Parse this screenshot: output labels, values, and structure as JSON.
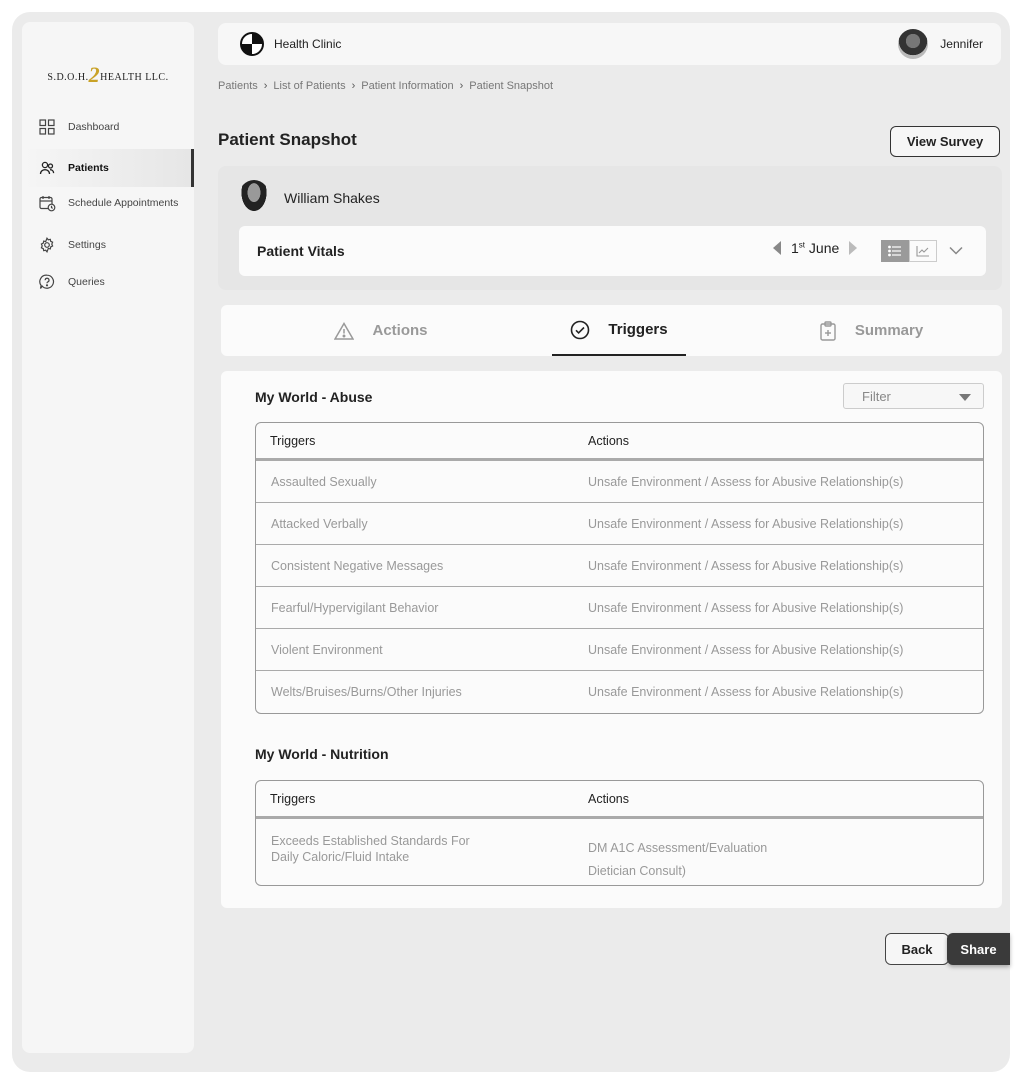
{
  "logo": {
    "prefix": "S.D.O.H.",
    "two": "2",
    "suffix": "HEALTH LLC."
  },
  "sidebar": {
    "items": [
      {
        "label": "Dashboard",
        "icon": "grid-icon"
      },
      {
        "label": "Patients",
        "icon": "users-icon",
        "active": true
      },
      {
        "label": "Schedule Appointments",
        "icon": "calendar-clock-icon"
      },
      {
        "label": "Settings",
        "icon": "gear-icon"
      },
      {
        "label": "Queries",
        "icon": "question-icon"
      }
    ]
  },
  "header": {
    "clinic": "Health Clinic",
    "user": "Jennifer"
  },
  "breadcrumb": [
    "Patients",
    "List of Patients",
    "Patient Information",
    "Patient Snapshot"
  ],
  "page": {
    "title": "Patient Snapshot",
    "view_survey": "View Survey"
  },
  "patient": {
    "name": "William Shakes"
  },
  "vitals": {
    "label": "Patient Vitals",
    "date_day": "1",
    "date_suffix": "st",
    "date_month": "June"
  },
  "tabs": [
    {
      "label": "Actions",
      "icon": "warning-icon"
    },
    {
      "label": "Triggers",
      "icon": "check-circle-icon",
      "active": true
    },
    {
      "label": "Summary",
      "icon": "clipboard-plus-icon"
    }
  ],
  "filter": {
    "label": "Filter"
  },
  "abuse": {
    "title": "My World - Abuse",
    "headers": [
      "Triggers",
      "Actions"
    ],
    "rows": [
      {
        "trigger": "Assaulted Sexually",
        "action": "Unsafe Environment / Assess for Abusive Relationship(s)"
      },
      {
        "trigger": "Attacked Verbally",
        "action": "Unsafe Environment / Assess for Abusive Relationship(s)"
      },
      {
        "trigger": "Consistent Negative Messages",
        "action": "Unsafe Environment / Assess for Abusive Relationship(s)"
      },
      {
        "trigger": "Fearful/Hypervigilant Behavior",
        "action": "Unsafe Environment / Assess for Abusive Relationship(s)"
      },
      {
        "trigger": "Violent Environment",
        "action": "Unsafe Environment / Assess for Abusive Relationship(s)"
      },
      {
        "trigger": "Welts/Bruises/Burns/Other Injuries",
        "action": "Unsafe Environment / Assess for Abusive Relationship(s)"
      }
    ]
  },
  "nutrition": {
    "title": "My World - Nutrition",
    "headers": [
      "Triggers",
      "Actions"
    ],
    "rows": [
      {
        "trigger_line1": "Exceeds Established Standards For",
        "trigger_line2": "Daily Caloric/Fluid Intake",
        "action_line1": "DM A1C Assessment/Evaluation",
        "action_line2": "Dietician Consult)"
      }
    ]
  },
  "footer": {
    "back": "Back",
    "share": "Share"
  }
}
